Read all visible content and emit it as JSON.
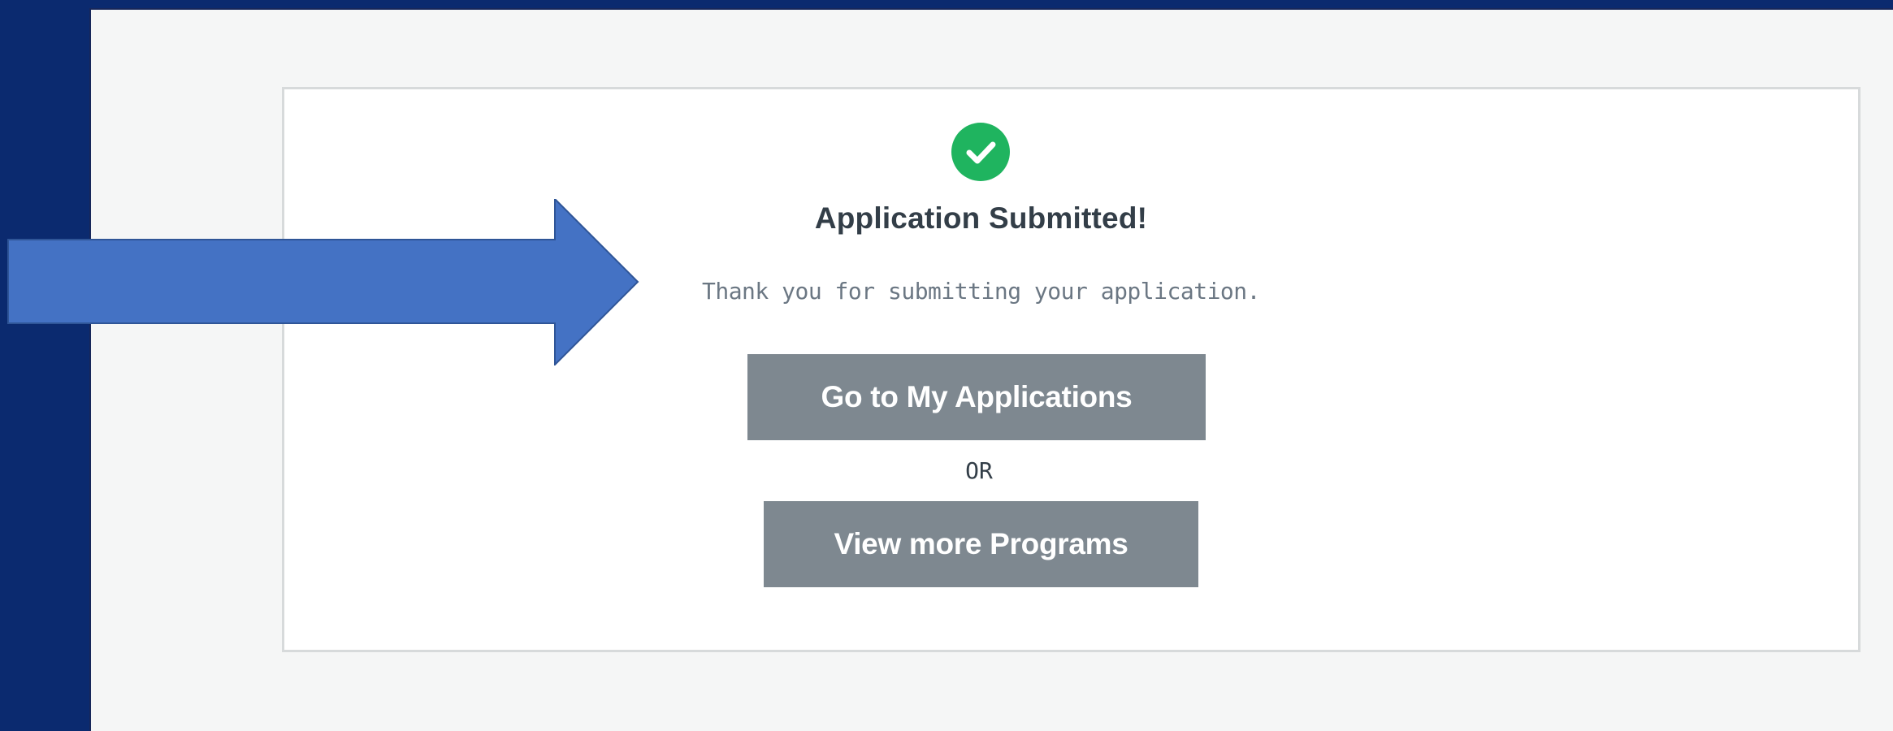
{
  "confirmation": {
    "icon": "check-circle-icon",
    "title": "Application Submitted!",
    "message": "Thank you for submitting your application.",
    "primary_button_label": "Go to My Applications",
    "separator": "OR",
    "secondary_button_label": "View more Programs"
  },
  "annotation": {
    "icon": "right-arrow-icon"
  },
  "colors": {
    "success_green": "#1fb45f",
    "button_gray": "#7e8890",
    "arrow_blue": "#4472c4",
    "frame_navy": "#0b2a6f"
  }
}
